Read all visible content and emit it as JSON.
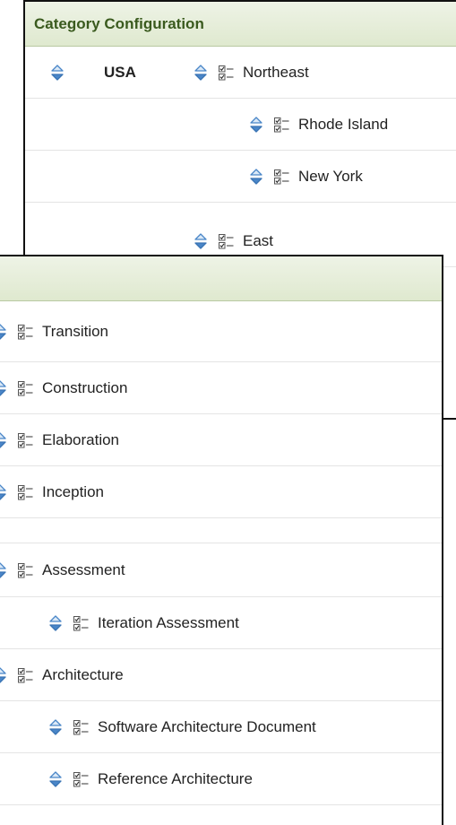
{
  "back_panel": {
    "title": "Category Configuration",
    "root_label": "USA",
    "regions": [
      {
        "label": "Northeast",
        "level": 0
      },
      {
        "label": "Rhode Island",
        "level": 1
      },
      {
        "label": "New York",
        "level": 1
      },
      {
        "label": "East",
        "level": 0
      }
    ]
  },
  "front_panel": {
    "title": "",
    "groups": [
      {
        "label": "Transition",
        "level": 0
      },
      {
        "label": "Construction",
        "level": 0
      },
      {
        "label": "Elaboration",
        "level": 0
      },
      {
        "label": "Inception",
        "level": 0
      },
      {
        "label": "Assessment",
        "level": 0
      },
      {
        "label": "Iteration Assessment",
        "level": 1
      },
      {
        "label": "Architecture",
        "level": 0
      },
      {
        "label": "Software Architecture Document",
        "level": 1
      },
      {
        "label": "Reference Architecture",
        "level": 1
      }
    ]
  },
  "icons": {
    "sort": "sort-up-down-icon",
    "list": "checklist-icon"
  },
  "colors": {
    "header_bg": "#e4ecd8",
    "header_text": "#3a5a1e",
    "sort_icon": "#4a86c8",
    "border": "#111111"
  }
}
